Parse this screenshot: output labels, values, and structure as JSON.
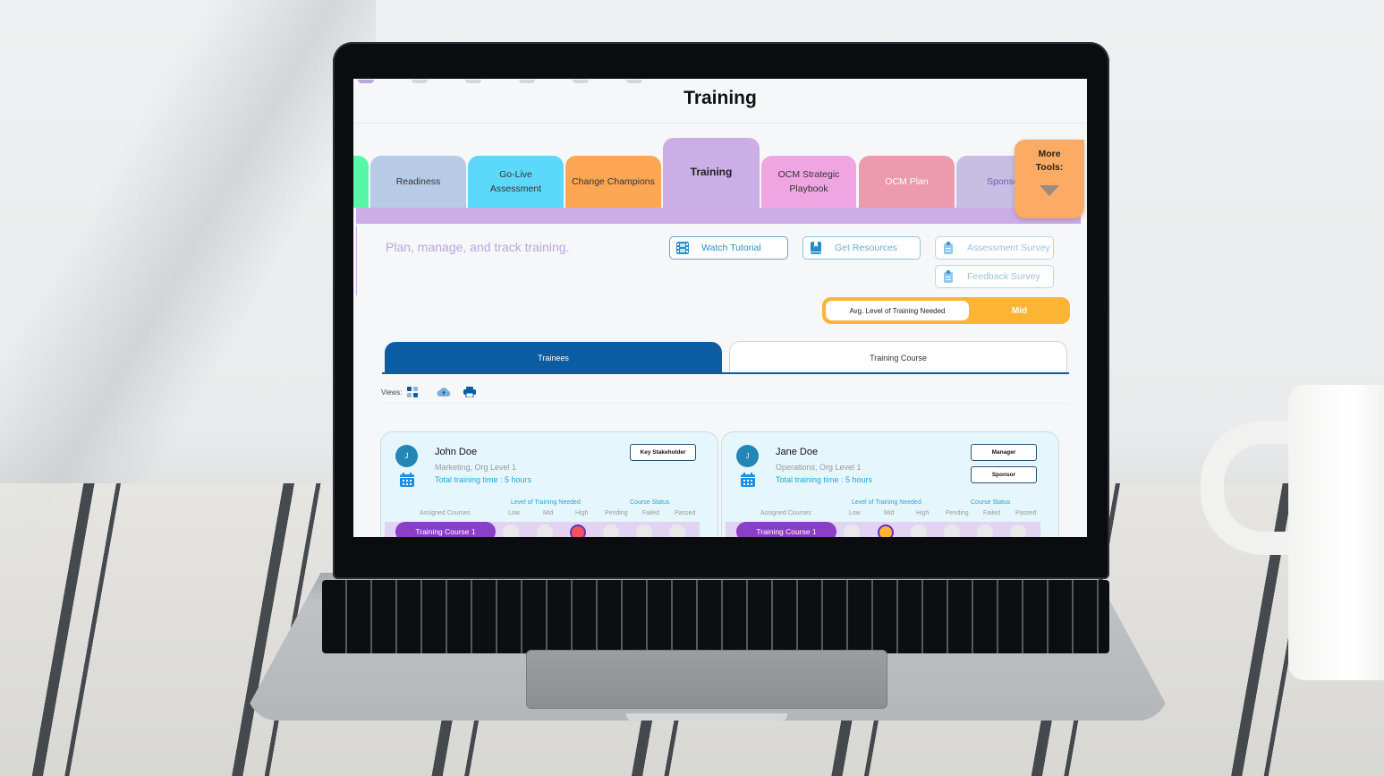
{
  "screen": {
    "page_title": "Training",
    "tabs": [
      {
        "label": "Readiness",
        "color": "#b8cbe6"
      },
      {
        "label": "Go-Live Assessment",
        "color": "#5cd9fa"
      },
      {
        "label": "Change Champions",
        "color": "#fda653"
      },
      {
        "label": "Training",
        "color": "#cbaee6",
        "active": true
      },
      {
        "label": "OCM Strategic Playbook",
        "color": "#f0a5e3"
      },
      {
        "label": "OCM Plan",
        "color": "#ed9aae"
      },
      {
        "label": "Sponsor",
        "color": "#c8bde3"
      }
    ],
    "partial_tab_color": "#57f7a8",
    "more_tools": {
      "line1": "More",
      "line2": "Tools:"
    },
    "subtitle": "Plan, manage, and track training.",
    "buttons": {
      "watch_tutorial": "Watch Tutorial",
      "get_resources": "Get Resources",
      "assessment_survey": "Assessment Survey",
      "feedback_survey": "Feedback Survey"
    },
    "avg_training": {
      "label": "Avg. Level of Training Needed",
      "value": "Mid"
    },
    "view_tabs": {
      "trainees": "Trainees",
      "training_course": "Training Course"
    },
    "views_label": "Views:",
    "card_headers": {
      "level_needed": "Level of Training Needed",
      "course_status": "Course Status",
      "assigned_courses": "Assigned Courses",
      "low": "Low",
      "mid": "Mid",
      "high": "High",
      "pending": "Pending",
      "failed": "Failed",
      "passed": "Passed"
    },
    "trainees": [
      {
        "initial": "J",
        "name": "John Doe",
        "dept": "Marketing, Org Level 1",
        "time": "Total training time : 5 hours",
        "roles": [
          "Key Stakeholder"
        ],
        "course": "Training Course 1",
        "level_selected": "High",
        "level_color": "#f5535a"
      },
      {
        "initial": "J",
        "name": "Jane Doe",
        "dept": "Operations, Org Level 1",
        "time": "Total training time : 5 hours",
        "roles": [
          "Manager",
          "Sponsor"
        ],
        "course": "Training Course 1",
        "level_selected": "Mid",
        "level_color": "#fbb434"
      }
    ]
  }
}
